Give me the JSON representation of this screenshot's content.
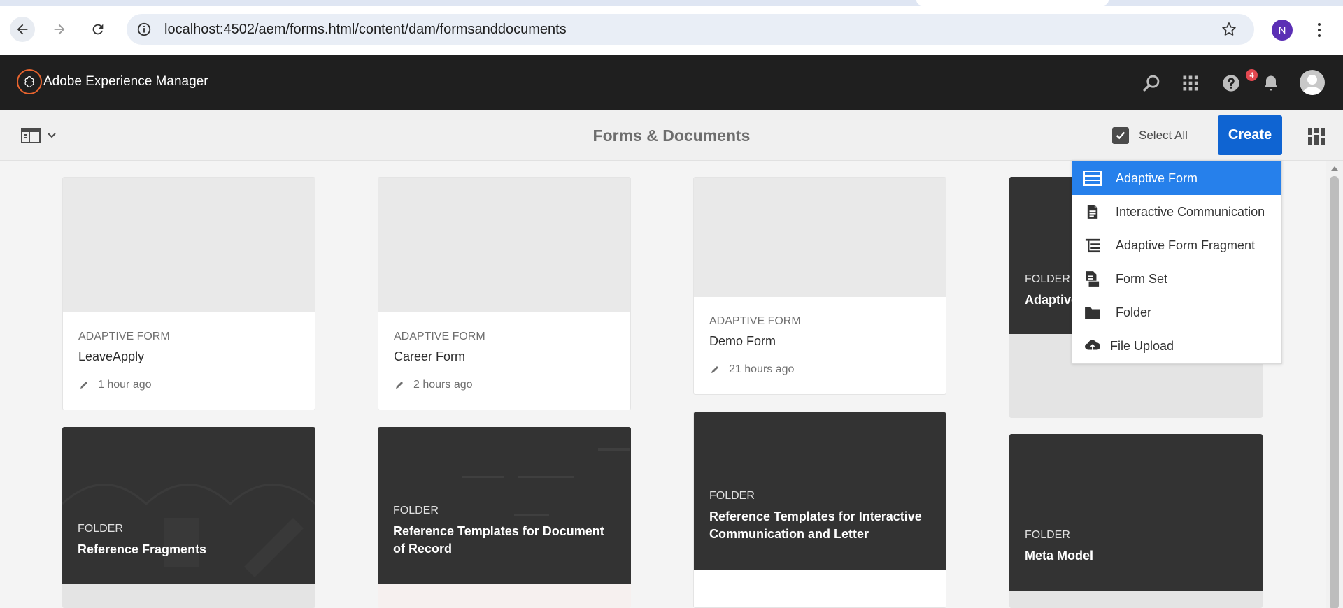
{
  "browser": {
    "url": "localhost:4502/aem/forms.html/content/dam/formsanddocuments",
    "profile_initial": "N"
  },
  "shell": {
    "app_title": "Adobe Experience Manager",
    "notification_count": "4",
    "icons": [
      "search-icon",
      "apps-icon",
      "help-icon",
      "bell-icon",
      "user-avatar"
    ]
  },
  "actionbar": {
    "page_title": "Forms & Documents",
    "select_all_label": "Select All",
    "create_label": "Create"
  },
  "create_menu": {
    "items": [
      {
        "label": "Adaptive Form",
        "icon": "adaptive-form-icon",
        "selected": true
      },
      {
        "label": "Interactive Communication",
        "icon": "document-icon"
      },
      {
        "label": "Adaptive Form Fragment",
        "icon": "fragment-tree-icon"
      },
      {
        "label": "Form Set",
        "icon": "form-set-icon"
      },
      {
        "label": "Folder",
        "icon": "folder-icon"
      },
      {
        "label": "File Upload",
        "icon": "cloud-upload-icon"
      }
    ]
  },
  "cards": [
    {
      "kind": "ADAPTIVE FORM",
      "name": "LeaveApply",
      "modified": "1 hour ago"
    },
    {
      "kind": "ADAPTIVE FORM",
      "name": "Career Form",
      "modified": "2 hours ago"
    },
    {
      "kind": "ADAPTIVE FORM",
      "name": "Demo Form",
      "modified": "21 hours ago"
    }
  ],
  "folders": [
    {
      "kind": "FOLDER",
      "name": "Adaptive"
    },
    {
      "kind": "FOLDER",
      "name": "Reference Fragments"
    },
    {
      "kind": "FOLDER",
      "name": "Reference Templates for Document of Record"
    },
    {
      "kind": "FOLDER",
      "name": "Reference Templates for Interactive Communication and Letter"
    },
    {
      "kind": "FOLDER",
      "name": "Meta Model"
    }
  ],
  "colors": {
    "shell_bg": "#1f1f1f",
    "accent": "#1473e6",
    "menu_selected": "#2680eb",
    "folder_bg": "#333333"
  }
}
